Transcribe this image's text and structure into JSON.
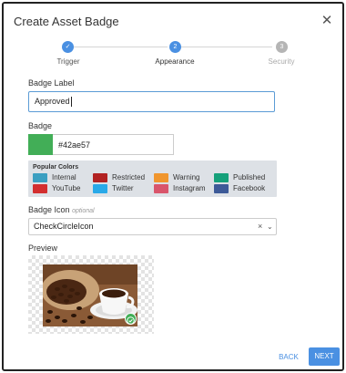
{
  "dialog": {
    "title": "Create Asset Badge",
    "close_icon": "close-icon"
  },
  "stepper": {
    "steps": [
      {
        "label": "Trigger",
        "marker": "✓",
        "state": "completed"
      },
      {
        "label": "Appearance",
        "marker": "2",
        "state": "active"
      },
      {
        "label": "Security",
        "marker": "3",
        "state": "upcoming"
      }
    ]
  },
  "form": {
    "badge_label": {
      "label": "Badge Label",
      "value": "Approved"
    },
    "badge": {
      "label": "Badge",
      "value": "#42ae57",
      "swatch_color": "#42ae57"
    },
    "popular_colors": {
      "title": "Popular Colors",
      "items": [
        {
          "name": "Internal",
          "color": "#3b9fc1"
        },
        {
          "name": "Restricted",
          "color": "#b22222"
        },
        {
          "name": "Warning",
          "color": "#f0962e"
        },
        {
          "name": "Published",
          "color": "#15a07a"
        },
        {
          "name": "YouTube",
          "color": "#d32f2f"
        },
        {
          "name": "Twitter",
          "color": "#29a9e8"
        },
        {
          "name": "Instagram",
          "color": "#d9556b"
        },
        {
          "name": "Facebook",
          "color": "#3d5a98"
        }
      ]
    },
    "badge_icon": {
      "label": "Badge Icon",
      "optional": "optional",
      "value": "CheckCircleIcon",
      "clear": "×",
      "chevron": "⌄"
    },
    "preview": {
      "label": "Preview",
      "badge_color": "#42ae57"
    }
  },
  "footer": {
    "back_label": "BACK",
    "next_label": "NEXT"
  },
  "colors": {
    "accent": "#4a90e2",
    "stepper_complete": "#4a90e2",
    "stepper_upcoming": "#b5b5b5"
  }
}
